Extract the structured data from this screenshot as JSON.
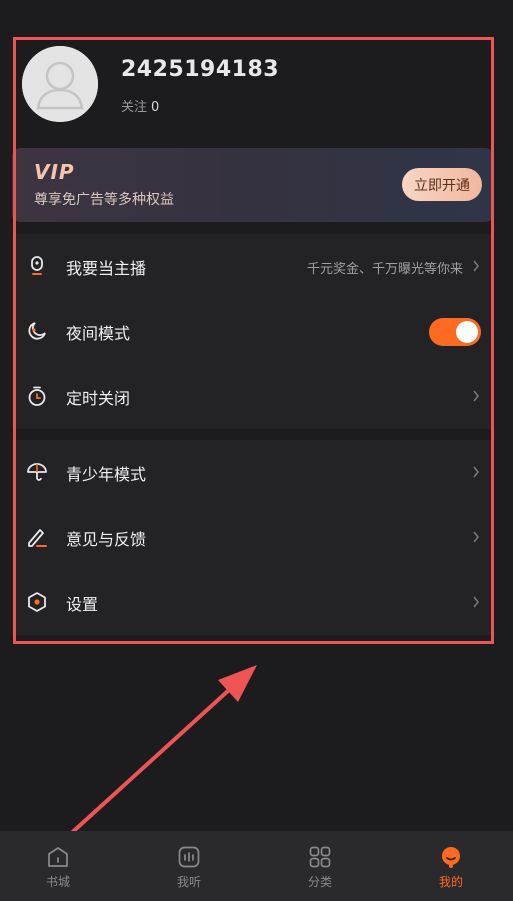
{
  "profile": {
    "username": "2425194183",
    "follow_label": "关注",
    "follow_count": "0"
  },
  "vip": {
    "logo": "VIP",
    "subtitle": "尊享免广告等多种权益",
    "button": "立即开通"
  },
  "menu_group_1": [
    {
      "label": "我要当主播",
      "hint": "千元奖金、千万曝光等你来",
      "icon": "microphone-icon"
    },
    {
      "label": "夜间模式",
      "toggle_on": true,
      "icon": "moon-icon"
    },
    {
      "label": "定时关闭",
      "icon": "timer-icon"
    }
  ],
  "menu_group_2": [
    {
      "label": "青少年模式",
      "icon": "umbrella-icon"
    },
    {
      "label": "意见与反馈",
      "icon": "pen-icon"
    },
    {
      "label": "设置",
      "icon": "hexagon-settings-icon"
    }
  ],
  "tabs": [
    {
      "label": "书城",
      "icon": "bookstore-icon",
      "active": false
    },
    {
      "label": "我听",
      "icon": "listen-icon",
      "active": false
    },
    {
      "label": "分类",
      "icon": "category-icon",
      "active": false
    },
    {
      "label": "我的",
      "icon": "mine-icon",
      "active": true
    }
  ],
  "colors": {
    "accent": "#ff6a22",
    "annotation": "#ee5454",
    "background": "#1c1c1e"
  }
}
